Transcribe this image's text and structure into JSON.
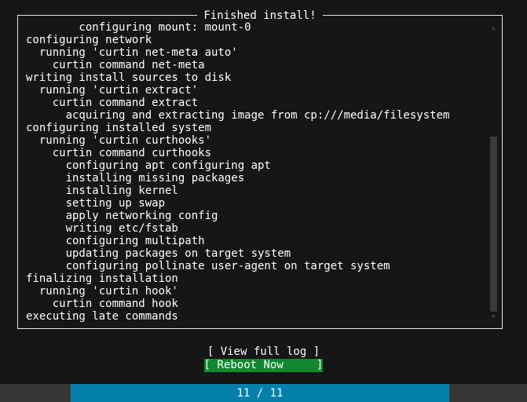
{
  "dialog": {
    "title": "Finished install!",
    "log_lines": [
      "        configuring mount: mount-0",
      "configuring network",
      "  running 'curtin net-meta auto'",
      "    curtin command net-meta",
      "writing install sources to disk",
      "  running 'curtin extract'",
      "    curtin command extract",
      "      acquiring and extracting image from cp:///media/filesystem",
      "configuring installed system",
      "  running 'curtin curthooks'",
      "    curtin command curthooks",
      "      configuring apt configuring apt",
      "      installing missing packages",
      "      installing kernel",
      "      setting up swap",
      "      apply networking config",
      "      writing etc/fstab",
      "      configuring multipath",
      "      updating packages on target system",
      "      configuring pollinate user-agent on target system",
      "finalizing installation",
      "  running 'curtin hook'",
      "    curtin command hook",
      "executing late commands"
    ]
  },
  "scrollbar": {
    "up_arrow": "▲",
    "down_arrow": "▼"
  },
  "buttons": [
    {
      "label": "[ View full log ]",
      "selected": false
    },
    {
      "label": "[ Reboot Now     ]",
      "selected": true
    }
  ],
  "progress": {
    "label": "11 / 11",
    "current": 11,
    "total": 11,
    "percent": 100,
    "fill_color": "#0580ab",
    "track_color": "#363636"
  },
  "colors": {
    "background": "#161616",
    "foreground": "#ffffff",
    "highlight": "#11882f",
    "scrollbar": "#3a3a3a"
  }
}
